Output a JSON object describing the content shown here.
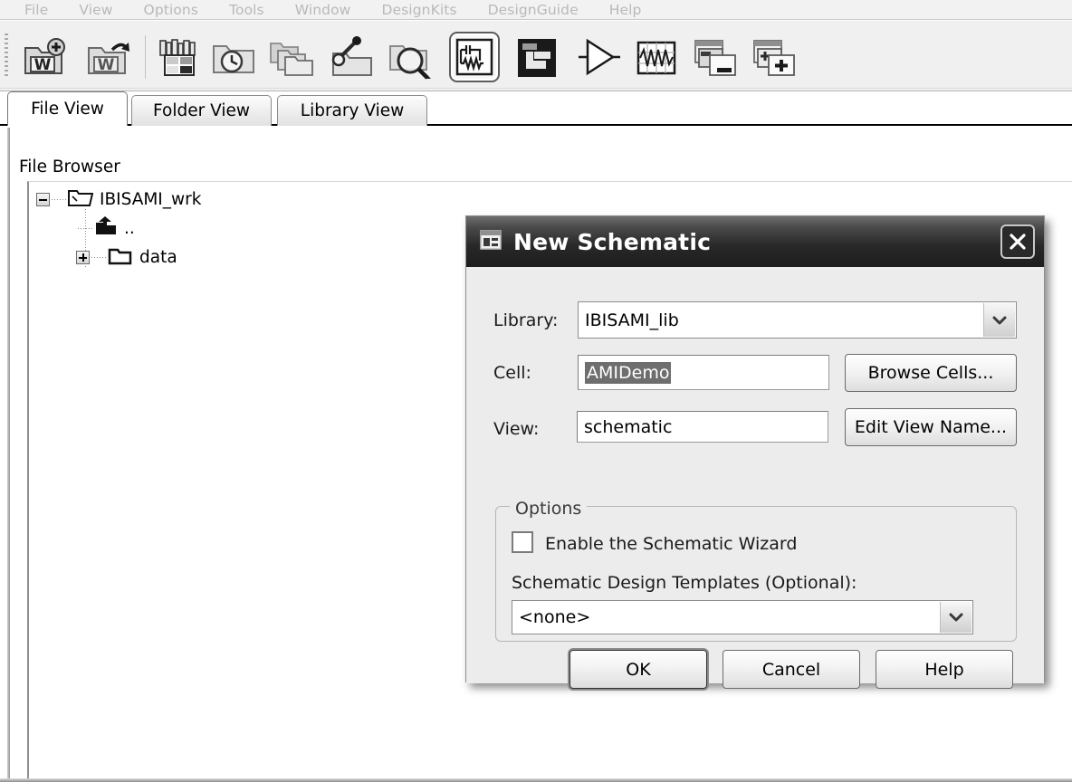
{
  "menubar": {
    "items": [
      {
        "label": "File",
        "name": "menu-file"
      },
      {
        "label": "View",
        "name": "menu-view"
      },
      {
        "label": "Options",
        "name": "menu-options"
      },
      {
        "label": "Tools",
        "name": "menu-tools"
      },
      {
        "label": "Window",
        "name": "menu-window"
      },
      {
        "label": "DesignKits",
        "name": "menu-designkits"
      },
      {
        "label": "DesignGuide",
        "name": "menu-designguide"
      },
      {
        "label": "Help",
        "name": "menu-help"
      }
    ]
  },
  "toolbar": {
    "icons": [
      "new-workspace-icon",
      "open-workspace-icon",
      "design-kits-icon",
      "recent-workspaces-icon",
      "copy-workspace-icon",
      "workspace-tools-icon",
      "find-files-icon",
      "new-schematic-icon",
      "new-layout-icon",
      "new-symbol-icon",
      "new-data-display-icon",
      "close-window-icon",
      "add-window-icon"
    ],
    "selected_icon": "new-schematic-icon"
  },
  "tabs": [
    {
      "label": "File View",
      "active": true
    },
    {
      "label": "Folder View",
      "active": false
    },
    {
      "label": "Library View",
      "active": false
    }
  ],
  "browser": {
    "title": "File Browser",
    "tree": [
      {
        "label": "IBISAMI_wrk",
        "state": "expanded",
        "icon": "open-folder-icon"
      },
      {
        "label": "..",
        "state": "leaf",
        "icon": "parent-folder-icon"
      },
      {
        "label": "data",
        "state": "collapsed",
        "icon": "folder-icon"
      }
    ]
  },
  "dialog": {
    "title": "New Schematic",
    "title_icon": "schematic-window-icon",
    "close_icon": "close-icon",
    "library": {
      "label": "Library:",
      "value": "IBISAMI_lib"
    },
    "cell": {
      "label": "Cell:",
      "value": "AMIDemo",
      "selected": true,
      "browse_label": "Browse Cells..."
    },
    "view": {
      "label": "View:",
      "value": "schematic",
      "edit_label": "Edit View Name..."
    },
    "options": {
      "legend": "Options",
      "wizard_label": "Enable the Schematic Wizard",
      "wizard_checked": false,
      "templates_label": "Schematic Design Templates (Optional):",
      "templates_value": "<none>"
    },
    "buttons": {
      "ok": "OK",
      "cancel": "Cancel",
      "help": "Help"
    }
  },
  "colors": {
    "dialog_titlebar_dark": "#1d1d1d",
    "dialog_body": "#ececec",
    "menu_disabled_text": "#b9b9b9",
    "selection_highlight": "#6e6e6e",
    "toolbar_bg": "#f0f0f0"
  }
}
